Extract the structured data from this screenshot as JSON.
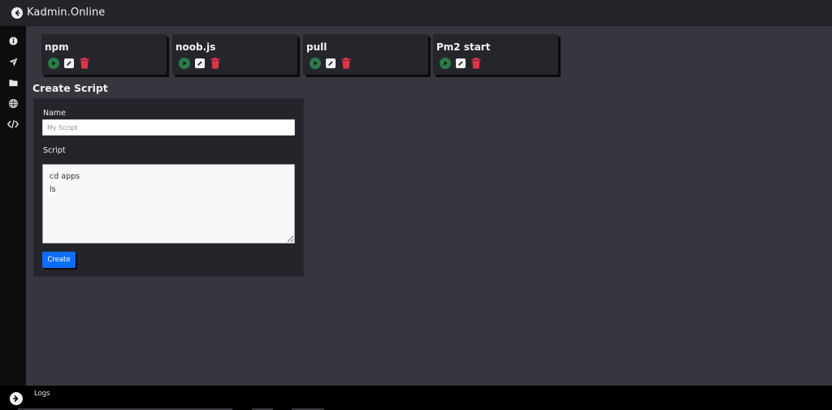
{
  "header": {
    "brand_title": "Kadmin.Online",
    "brand_icon": "arrow-left-circle-icon"
  },
  "sidebar": {
    "items": [
      {
        "name": "info-icon"
      },
      {
        "name": "send-icon"
      },
      {
        "name": "folder-icon"
      },
      {
        "name": "globe-icon"
      },
      {
        "name": "code-icon"
      }
    ]
  },
  "scripts": [
    {
      "title": "npm"
    },
    {
      "title": "noob.js"
    },
    {
      "title": "pull"
    },
    {
      "title": "Pm2 start"
    }
  ],
  "create_form": {
    "section_title": "Create Script",
    "name_label": "Name",
    "name_placeholder": "My Script",
    "name_value": "",
    "script_label": "Script",
    "script_value": "cd apps\nls",
    "submit_label": "Create"
  },
  "footer": {
    "logs_label": "Logs"
  },
  "colors": {
    "background": "#36363f",
    "card": "#25262c",
    "run": "#2b7a4b",
    "delete": "#e0344a",
    "primary": "#0d6efd",
    "sidebar": "#0d0d0d"
  }
}
